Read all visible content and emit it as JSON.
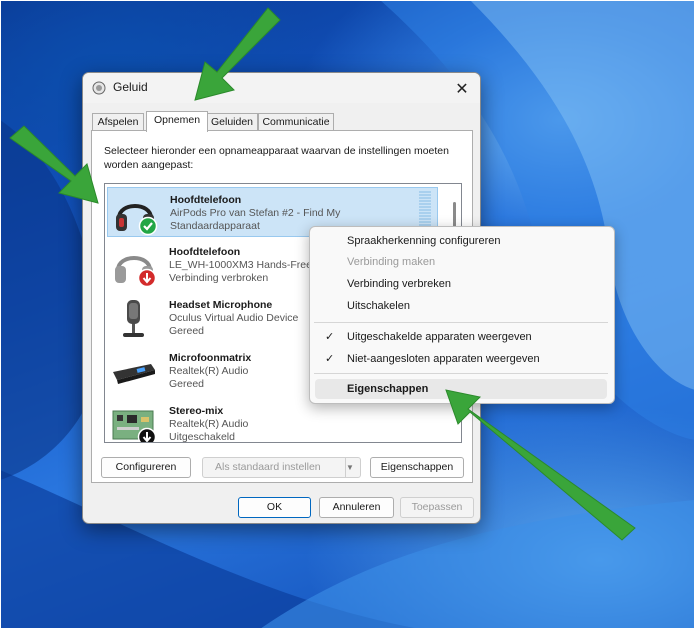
{
  "dialog": {
    "title": "Geluid",
    "close_glyph": "✕",
    "tabs": [
      {
        "label": "Afspelen"
      },
      {
        "label": "Opnemen"
      },
      {
        "label": "Geluiden"
      },
      {
        "label": "Communicatie"
      }
    ],
    "instructions": "Selecteer hieronder een opnameapparaat waarvan de instellingen moeten worden aangepast:",
    "devices": [
      {
        "name": "Hoofdtelefoon",
        "sub": "AirPods Pro van Stefan #2 - Find My",
        "status": "Standaardapparaat",
        "icon": "headphones-default-icon"
      },
      {
        "name": "Hoofdtelefoon",
        "sub": "LE_WH-1000XM3 Hands-Free",
        "status": "Verbinding verbroken",
        "icon": "headphones-disconnected-icon"
      },
      {
        "name": "Headset Microphone",
        "sub": "Oculus Virtual Audio Device",
        "status": "Gereed",
        "icon": "microphone-icon"
      },
      {
        "name": "Microfoonmatrix",
        "sub": "Realtek(R) Audio",
        "status": "Gereed",
        "icon": "microphone-array-icon"
      },
      {
        "name": "Stereo-mix",
        "sub": "Realtek(R) Audio",
        "status": "Uitgeschakeld",
        "icon": "circuit-board-disabled-icon"
      }
    ],
    "buttons": {
      "configure": "Configureren",
      "set_default": "Als standaard instellen",
      "properties": "Eigenschappen",
      "ok": "OK",
      "cancel": "Annuleren",
      "apply": "Toepassen"
    }
  },
  "context_menu": {
    "items": [
      {
        "label": "Spraakherkenning configureren",
        "enabled": true,
        "checked": false
      },
      {
        "label": "Verbinding maken",
        "enabled": false,
        "checked": false
      },
      {
        "label": "Verbinding verbreken",
        "enabled": true,
        "checked": false
      },
      {
        "label": "Uitschakelen",
        "enabled": true,
        "checked": false
      },
      {
        "label": "Uitgeschakelde apparaten weergeven",
        "enabled": true,
        "checked": true
      },
      {
        "label": "Niet-aangesloten apparaten weergeven",
        "enabled": true,
        "checked": true
      },
      {
        "label": "Eigenschappen",
        "enabled": true,
        "checked": false,
        "highlighted": true
      }
    ]
  },
  "colors": {
    "arrow": "#3aa53a",
    "selection": "#cce4f7",
    "default_badge": "#22a645",
    "disconnected_badge": "#d32b2b"
  }
}
